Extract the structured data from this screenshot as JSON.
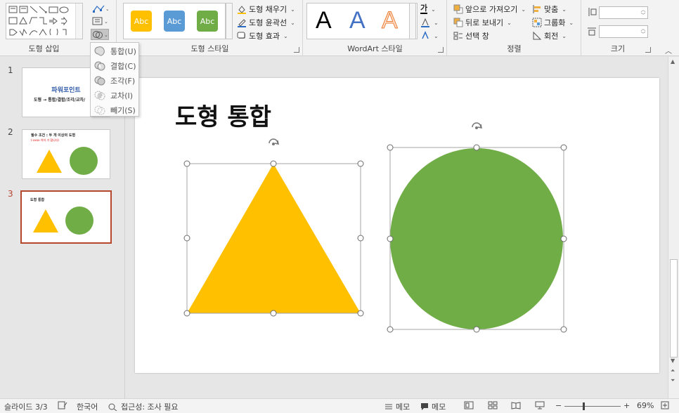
{
  "ribbon": {
    "groups": {
      "insert_shapes": "도형 삽입",
      "shape_styles": "도형 스타일",
      "wordart_styles": "WordArt 스타일",
      "arrange": "정렬",
      "size": "크기"
    },
    "style_gallery": [
      {
        "label": "Abc",
        "color": "#ffc000"
      },
      {
        "label": "Abc",
        "color": "#5b9bd5"
      },
      {
        "label": "Abc",
        "color": "#70ad47"
      }
    ],
    "shape_fill": "도형 채우기",
    "shape_outline": "도형 윤곽선",
    "shape_effects": "도형 효과",
    "wordart_letters": [
      "A",
      "A",
      "A"
    ],
    "text_fill_glyph": "가",
    "bring_forward": "앞으로 가져오기",
    "send_backward": "뒤로 보내기",
    "selection_pane": "선택 창",
    "align": "맞춤",
    "group": "그룹화",
    "rotate": "회전",
    "height_value": "",
    "width_value": ""
  },
  "merge_menu": [
    {
      "label": "통합(U)"
    },
    {
      "label": "결합(C)"
    },
    {
      "label": "조각(F)"
    },
    {
      "label": "교차(I)"
    },
    {
      "label": "빼기(S)"
    }
  ],
  "thumbnails": [
    {
      "number": "1",
      "title": "파워포인트",
      "subtitle": "도형 → 통합/결합/조각/교차/"
    },
    {
      "number": "2",
      "title": "필수 조건 : 두 개 이상의 도형",
      "subtitle": "(-xxxx 이어 가 합니다)"
    },
    {
      "number": "3",
      "title": "도형 통합"
    }
  ],
  "slide": {
    "title": "도형 통합",
    "triangle_color": "#ffc000",
    "circle_color": "#70ad47"
  },
  "status": {
    "slide_indicator": "슬라이드 3/3",
    "language": "한국어",
    "accessibility": "접근성: 조사 필요",
    "notes1": "메모",
    "notes2": "메모",
    "zoom": "69%"
  }
}
